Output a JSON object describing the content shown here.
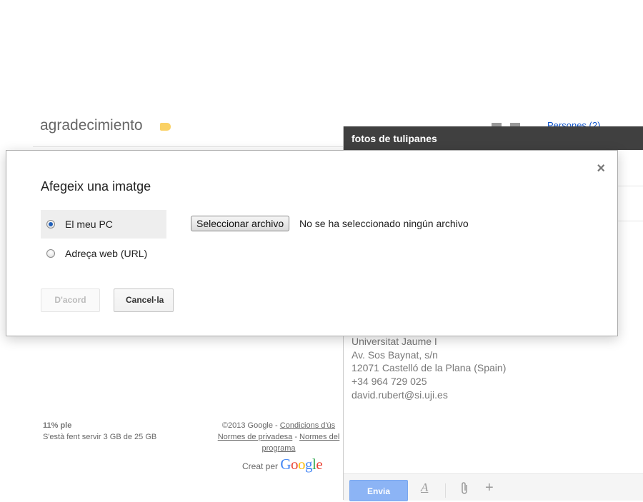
{
  "thread": {
    "subject": "agradecimiento",
    "people_link": "Persones (2)"
  },
  "storage": {
    "used_percent": "11% ple",
    "detail": "S'està fent servir 3 GB de 25 GB"
  },
  "footer": {
    "copyright": "©2013 Google - ",
    "terms": "Condicions d'ús",
    "privacy": "Normes de privadesa",
    "sep": " - ",
    "program": "Normes del programa",
    "creat_per": "Creat per",
    "google": "Google"
  },
  "compose": {
    "title": "fotos de tulipanes",
    "signature": [
      "Universitat Jaume I",
      "Av. Sos Baynat, s/n",
      "12071 Castelló de la Plana (Spain)",
      "+34 964 729 025",
      "david.rubert@si.uji.es"
    ],
    "send_label": "Envia",
    "format_icon": "A",
    "attach_icon": "paperclip",
    "more_icon": "+"
  },
  "dialog": {
    "title": "Afegeix una imatge",
    "close_glyph": "×",
    "options": [
      {
        "label": "El meu PC",
        "selected": true
      },
      {
        "label": "Adreça web (URL)",
        "selected": false
      }
    ],
    "file_button": "Seleccionar archivo",
    "file_status": "No se ha seleccionado ningún archivo",
    "ok_label": "D'acord",
    "cancel_label": "Cancel·la"
  },
  "colors": {
    "compose_header": "#404040",
    "send_button": "#8cb4f5",
    "link": "#1155cc",
    "label_tag": "#fad165"
  }
}
